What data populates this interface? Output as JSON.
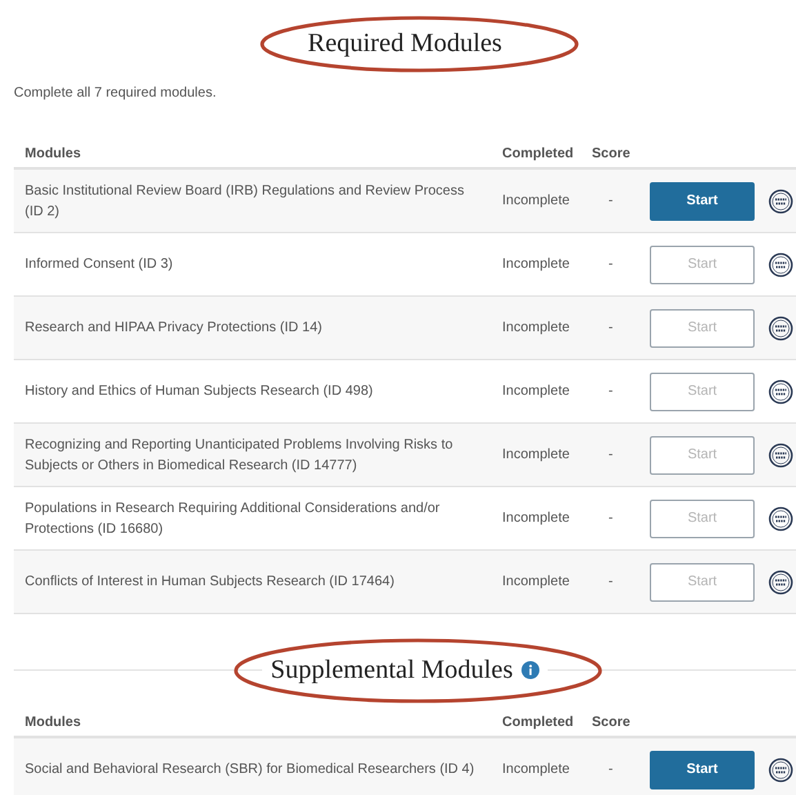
{
  "required": {
    "title": "Required Modules",
    "circled": true,
    "info_icon": false,
    "intro": "Complete all 7 required modules.",
    "columns": [
      "Modules",
      "Completed",
      "Score"
    ],
    "rows": [
      {
        "module": "Basic Institutional Review Board (IRB) Regulations and Review Process (ID 2)",
        "completed": "Incomplete",
        "score": "-",
        "action": "Start",
        "enabled": true
      },
      {
        "module": "Informed Consent (ID 3)",
        "completed": "Incomplete",
        "score": "-",
        "action": "Start",
        "enabled": false
      },
      {
        "module": "Research and HIPAA Privacy Protections (ID 14)",
        "completed": "Incomplete",
        "score": "-",
        "action": "Start",
        "enabled": false
      },
      {
        "module": "History and Ethics of Human Subjects Research (ID 498)",
        "completed": "Incomplete",
        "score": "-",
        "action": "Start",
        "enabled": false
      },
      {
        "module": "Recognizing and Reporting Unanticipated Problems Involving Risks to Subjects or Others in Biomedical Research (ID 14777)",
        "completed": "Incomplete",
        "score": "-",
        "action": "Start",
        "enabled": false
      },
      {
        "module": "Populations in Research Requiring Additional Considerations and/or Protections (ID 16680)",
        "completed": "Incomplete",
        "score": "-",
        "action": "Start",
        "enabled": false
      },
      {
        "module": "Conflicts of Interest in Human Subjects Research (ID 17464)",
        "completed": "Incomplete",
        "score": "-",
        "action": "Start",
        "enabled": false
      }
    ]
  },
  "supplemental": {
    "title": "Supplemental Modules",
    "circled": true,
    "info_icon": true,
    "columns": [
      "Modules",
      "Completed",
      "Score"
    ],
    "rows": [
      {
        "module": "Social and Behavioral Research (SBR) for Biomedical Researchers (ID 4)",
        "completed": "Incomplete",
        "score": "-",
        "action": "Start",
        "enabled": true
      }
    ]
  }
}
